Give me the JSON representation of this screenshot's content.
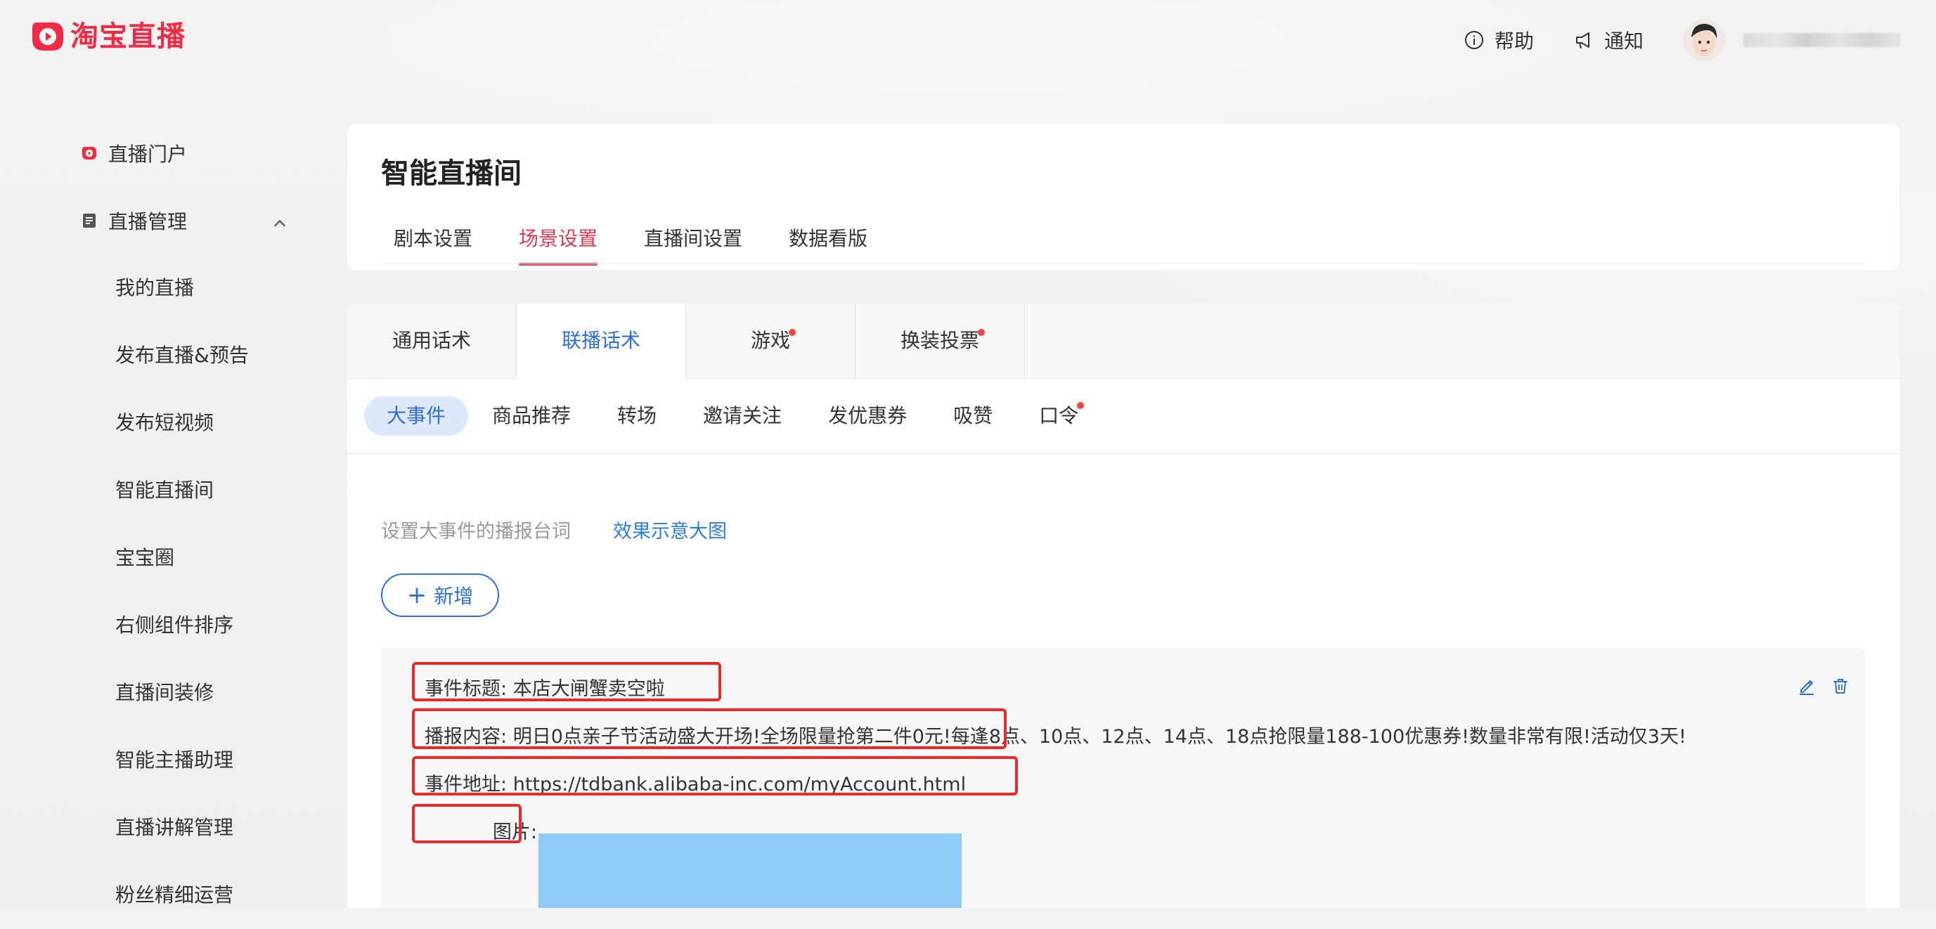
{
  "brand": {
    "logo_text": "淘宝直播",
    "accent": "#ef2b45"
  },
  "header": {
    "help_label": "帮助",
    "notify_label": "通知",
    "help_icon": "info-circle-icon",
    "notify_icon": "megaphone-icon"
  },
  "sidebar": {
    "portal_label": "直播门户",
    "manage_label": "直播管理",
    "items": [
      "我的直播",
      "发布直播&预告",
      "发布短视频",
      "智能直播间",
      "宝宝圈",
      "右侧组件排序",
      "直播间装修",
      "智能主播助理",
      "直播讲解管理",
      "粉丝精细运营"
    ]
  },
  "page": {
    "title": "智能直播间",
    "tabs": [
      "剧本设置",
      "场景设置",
      "直播间设置",
      "数据看版"
    ],
    "active_tab": "场景设置"
  },
  "secondary_tabs": {
    "items": [
      "通用话术",
      "联播话术",
      "游戏",
      "换装投票"
    ],
    "active": "联播话术"
  },
  "tertiary_tabs": {
    "items": [
      "大事件",
      "商品推荐",
      "转场",
      "邀请关注",
      "发优惠券",
      "吸赞",
      "口令"
    ],
    "active": "大事件"
  },
  "content": {
    "description": "设置大事件的播报台词",
    "effect_link": "效果示意大图",
    "add_button": "新增"
  },
  "event": {
    "title_label": "事件标题:",
    "title_value": "本店大闸蟹卖空啦",
    "content_label": "播报内容:",
    "content_value": "明日0点亲子节活动盛大开场!全场限量抢第二件0元!每逢8点、10点、12点、14点、18点抢限量188-100优惠券!数量非常有限!活动仅3天!",
    "address_label": "事件地址:",
    "address_value": "https://tdbank.alibaba-inc.com/myAccount.html",
    "image_label": "图片:"
  }
}
